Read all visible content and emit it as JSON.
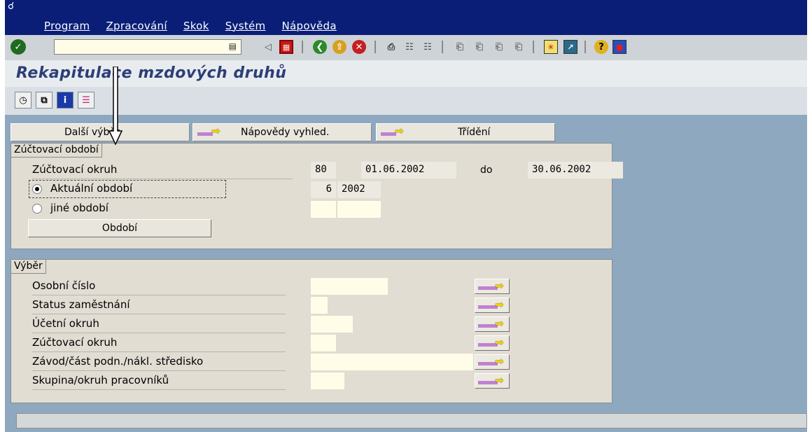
{
  "menubar": {
    "items": [
      "Program",
      "Zpracování",
      "Skok",
      "Systém",
      "Nápověda"
    ]
  },
  "toolbar": {
    "command_field_value": "",
    "icons": [
      "check-icon",
      "back-triangle-icon",
      "save-icon",
      "back-icon",
      "exit-icon",
      "cancel-icon",
      "print-icon",
      "find-icon",
      "find-next-icon",
      "first-page-icon",
      "prev-page-icon",
      "next-page-icon",
      "last-page-icon",
      "create-session-icon",
      "shortcut-icon",
      "help-icon",
      "layout-icon"
    ]
  },
  "title": "Rekapitulace mzdových druhů",
  "app_toolbar": {
    "icons": [
      "execute-icon",
      "copy-variant-icon",
      "info-icon",
      "settings-icon"
    ]
  },
  "selection_buttons": {
    "more_selection": "Další výběr",
    "search_help": "Nápovědy vyhled.",
    "sorting": "Třídění"
  },
  "period_group": {
    "title": "Zúčtovací období",
    "payroll_area_label": "Zúčtovací okruh",
    "payroll_area_value": "80",
    "date_from": "01.06.2002",
    "to_label": "do",
    "date_to": "30.06.2002",
    "current_period_label": "Aktuální období",
    "current_period_num": "6",
    "current_period_year": "2002",
    "other_period_label": "jiné období",
    "other_period_num": "",
    "other_period_year": "",
    "period_button": "Období"
  },
  "selection_group": {
    "title": "Výběr",
    "rows": [
      {
        "label": "Osobní číslo",
        "value": ""
      },
      {
        "label": "Status zaměstnání",
        "value": ""
      },
      {
        "label": "Účetní okruh",
        "value": ""
      },
      {
        "label": "Zúčtovací okruh",
        "value": ""
      },
      {
        "label": "Závod/část podn./nákl. středisko",
        "value": ""
      },
      {
        "label": "Skupina/okruh pracovníků",
        "value": ""
      }
    ]
  },
  "status_bar": {
    "text": ""
  }
}
